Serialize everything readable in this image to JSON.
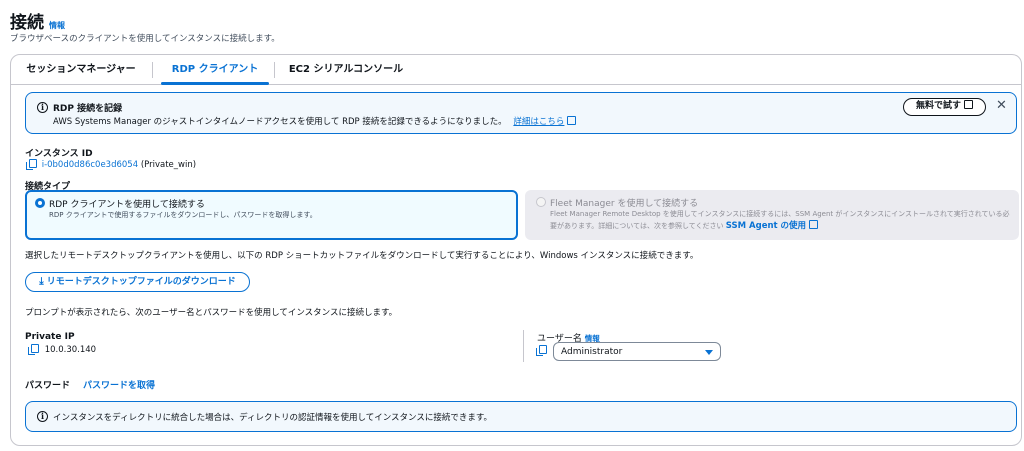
{
  "header": {
    "title": "接続",
    "info_link": "情報",
    "subtitle": "ブラウザベースのクライアントを使用してインスタンスに接続します。"
  },
  "tabs": [
    {
      "label": "セッションマネージャー",
      "active": false
    },
    {
      "label": "RDP クライアント",
      "active": true
    },
    {
      "label": "EC2 シリアルコンソール",
      "active": false
    }
  ],
  "alert": {
    "title": "RDP 接続を記録",
    "body": "AWS Systems Manager のジャストインタイムノードアクセスを使用して RDP 接続を記録できるようになりました。",
    "link": "詳細はこちら",
    "button": "無料で試す"
  },
  "instance": {
    "label": "インスタンス ID",
    "id": "i-0b0d0d86c0e3d6054",
    "name": "(Private_win)"
  },
  "connection_type": {
    "label": "接続タイプ",
    "options": [
      {
        "title": "RDP クライアントを使用して接続する",
        "desc": "RDP クライアントで使用するファイルをダウンロードし、パスワードを取得します。",
        "selected": true,
        "disabled": false
      },
      {
        "title": "Fleet Manager を使用して接続する",
        "desc": "Fleet Manager Remote Desktop を使用してインスタンスに接続するには、SSM Agent がインスタンスにインストールされて実行されている必要があります。詳細については、次を参照してください",
        "link": "SSM Agent の使用",
        "selected": false,
        "disabled": true
      }
    ]
  },
  "instructions": {
    "select_text": "選択したリモートデスクトップクライアントを使用し、以下の RDP ショートカットファイルをダウンロードして実行することにより、Windows インスタンスに接続できます。",
    "download_button": "リモートデスクトップファイルのダウンロード",
    "prompt_text": "プロンプトが表示されたら、次のユーザー名とパスワードを使用してインスタンスに接続します。"
  },
  "private_ip": {
    "label": "Private IP",
    "value": "10.0.30.140"
  },
  "username": {
    "label": "ユーザー名",
    "info_link": "情報",
    "selected": "Administrator"
  },
  "password": {
    "label": "パスワード",
    "link": "パスワードを取得"
  },
  "bottom_alert": {
    "text": "インスタンスをディレクトリに統合した場合は、ディレクトリの認証情報を使用してインスタンスに接続できます。"
  },
  "colors": {
    "accent": "#0972d3",
    "alert_bg": "#f2f8fd",
    "text": "#0f141a"
  }
}
